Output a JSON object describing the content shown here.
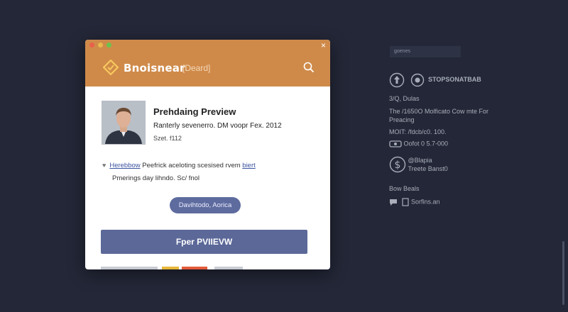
{
  "window": {
    "brand": "Bnoisnear",
    "brand_tag": "[Deard]",
    "close": "×"
  },
  "profile": {
    "title": "Prehdaing Preview",
    "subtitle": "Ranterly sevenerro. DM voopr Fex. 2012",
    "meta": "Szet. f112"
  },
  "description": {
    "line1_link": "Herebbow",
    "line1_text": " Peefrick aceloting scesised ",
    "line1_tail": "rvem ",
    "line1_link2": "biert",
    "line2": "Pmerings day lihndo. Sc/ fnol"
  },
  "actions": {
    "pill_label": "Davihtodo, Aorica",
    "primary_label": "Fper PVIIEVW"
  },
  "side_panel": {
    "search_placeholder": "goenes",
    "header": "STOPSONATBAB",
    "row1": "3/Q, Dulas",
    "row2a": "The  /1650O Molficato Cow mte For",
    "row2b": "Preacing",
    "row3": "MOIT:  /fdcb/c0. 100.",
    "row4": "Oofot 0 5.7-000",
    "row5a": "@Blapia",
    "row5b": "Treete Banst0",
    "section": "Bow Beals",
    "row6": "Sorfins.an"
  },
  "colors": {
    "titlebar": "#cf8a4a",
    "primary_button": "#5b6898",
    "background": "#232737"
  }
}
